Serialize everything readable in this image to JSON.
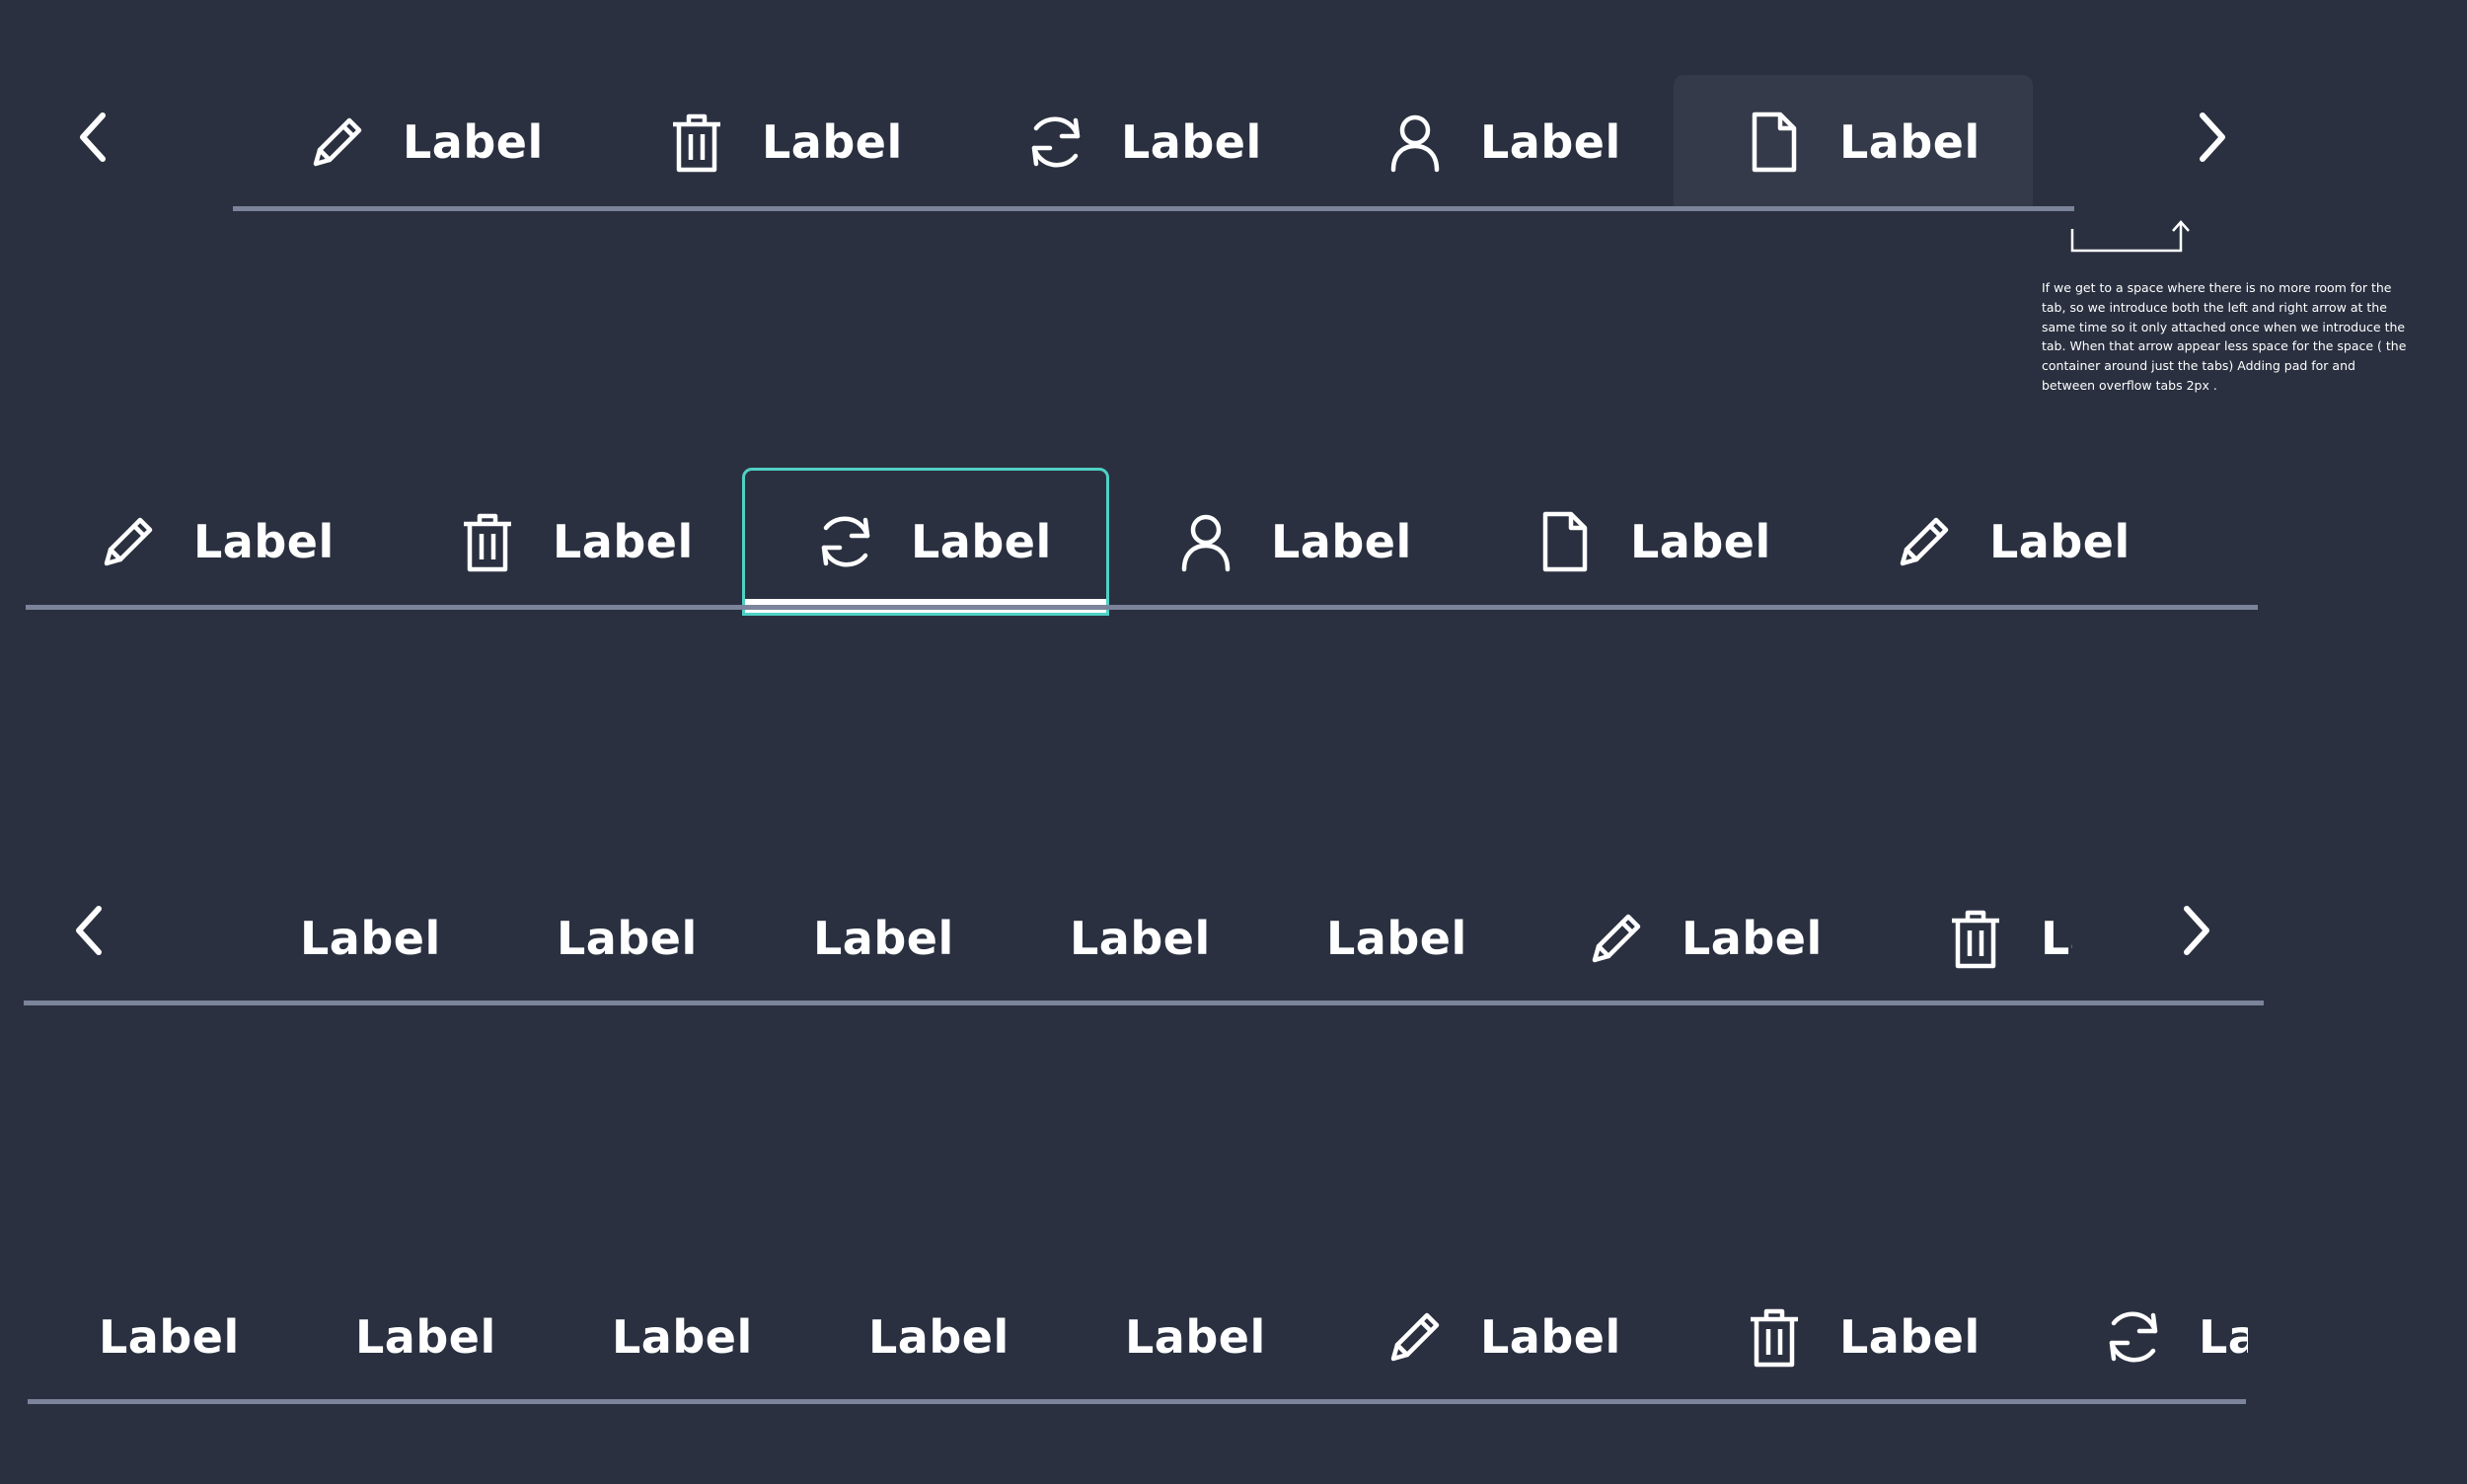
{
  "row1": {
    "tabs": [
      {
        "icon": "pencil-icon",
        "label": "Label"
      },
      {
        "icon": "trash-icon",
        "label": "Label"
      },
      {
        "icon": "refresh-icon",
        "label": "Label"
      },
      {
        "icon": "user-icon",
        "label": "Label"
      },
      {
        "icon": "file-icon",
        "label": "Label",
        "state": "selected"
      }
    ]
  },
  "row2": {
    "tabs": [
      {
        "icon": "pencil-icon",
        "label": "Label"
      },
      {
        "icon": "trash-icon",
        "label": "Label"
      },
      {
        "icon": "refresh-icon",
        "label": "Label",
        "state": "focused"
      },
      {
        "icon": "user-icon",
        "label": "Label"
      },
      {
        "icon": "file-icon",
        "label": "Label"
      },
      {
        "icon": "pencil-icon",
        "label": "Label"
      }
    ]
  },
  "row3": {
    "tabs": [
      {
        "label": "Label"
      },
      {
        "label": "Label"
      },
      {
        "label": "Label"
      },
      {
        "label": "Label"
      },
      {
        "label": "Label"
      },
      {
        "icon": "pencil-icon",
        "label": "Label"
      },
      {
        "icon": "trash-icon",
        "label": "Label"
      }
    ]
  },
  "row4": {
    "tabs": [
      {
        "label": "Label"
      },
      {
        "label": "Label"
      },
      {
        "label": "Label"
      },
      {
        "label": "Label"
      },
      {
        "label": "Label"
      },
      {
        "icon": "pencil-icon",
        "label": "Label"
      },
      {
        "icon": "trash-icon",
        "label": "Label"
      },
      {
        "icon": "refresh-icon",
        "label": "Label"
      }
    ]
  },
  "annotation": {
    "text": "If we get to a space where there is no more room for the tab, so we introduce both the left and right arrow at the same time so it only attached once when we introduce the tab. When that arrow appear less space for the space ( the container around just the tabs) Adding pad for and between overflow tabs 2px ."
  },
  "colors": {
    "background": "#2a3040",
    "rule": "#7b849a",
    "selected_tab_bg": "#343a49",
    "focus_ring": "#4fd1c5",
    "text": "#ffffff"
  }
}
